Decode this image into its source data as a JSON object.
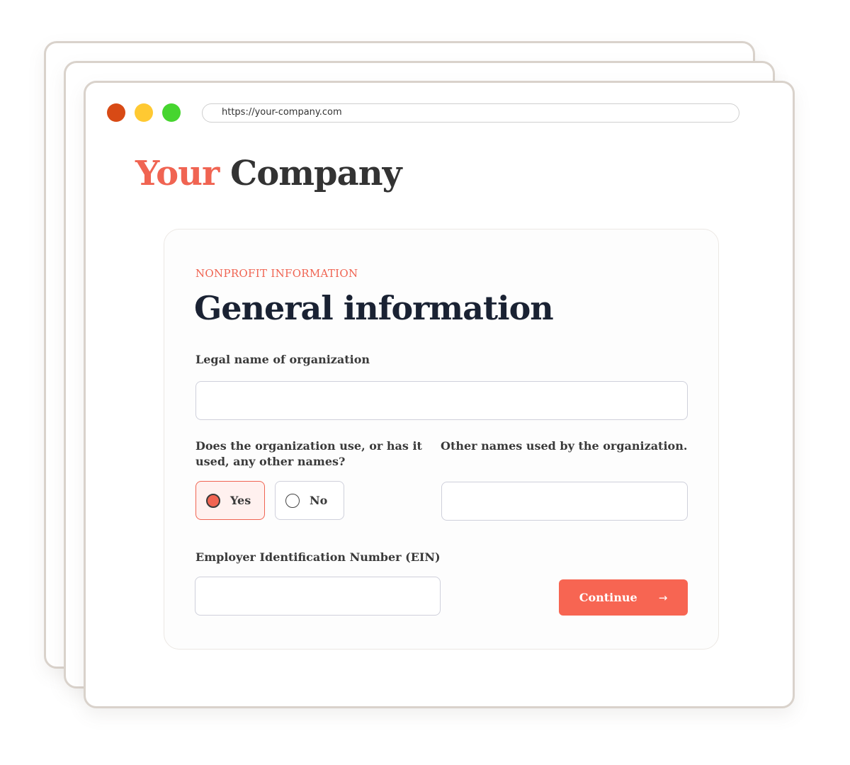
{
  "browser": {
    "url": "https://your-company.com"
  },
  "brand": {
    "accent_word": "Your",
    "main_word": "Company",
    "accent_color": "#f06452",
    "text_color": "#333333"
  },
  "form": {
    "eyebrow": "NONPROFIT INFORMATION",
    "title": "General information",
    "legal_name": {
      "label": "Legal name of organization",
      "value": ""
    },
    "other_names_question": {
      "label": "Does the organization use, or has it used, any other names?",
      "options": [
        {
          "label": "Yes",
          "selected": true
        },
        {
          "label": "No",
          "selected": false
        }
      ]
    },
    "other_names": {
      "label": "Other names used by the organization.",
      "value": ""
    },
    "ein": {
      "label": "Employer Identification Number (EIN)",
      "value": ""
    },
    "continue_label": "Continue",
    "continue_icon": "arrow-right-icon",
    "primary_color": "#f76552"
  }
}
